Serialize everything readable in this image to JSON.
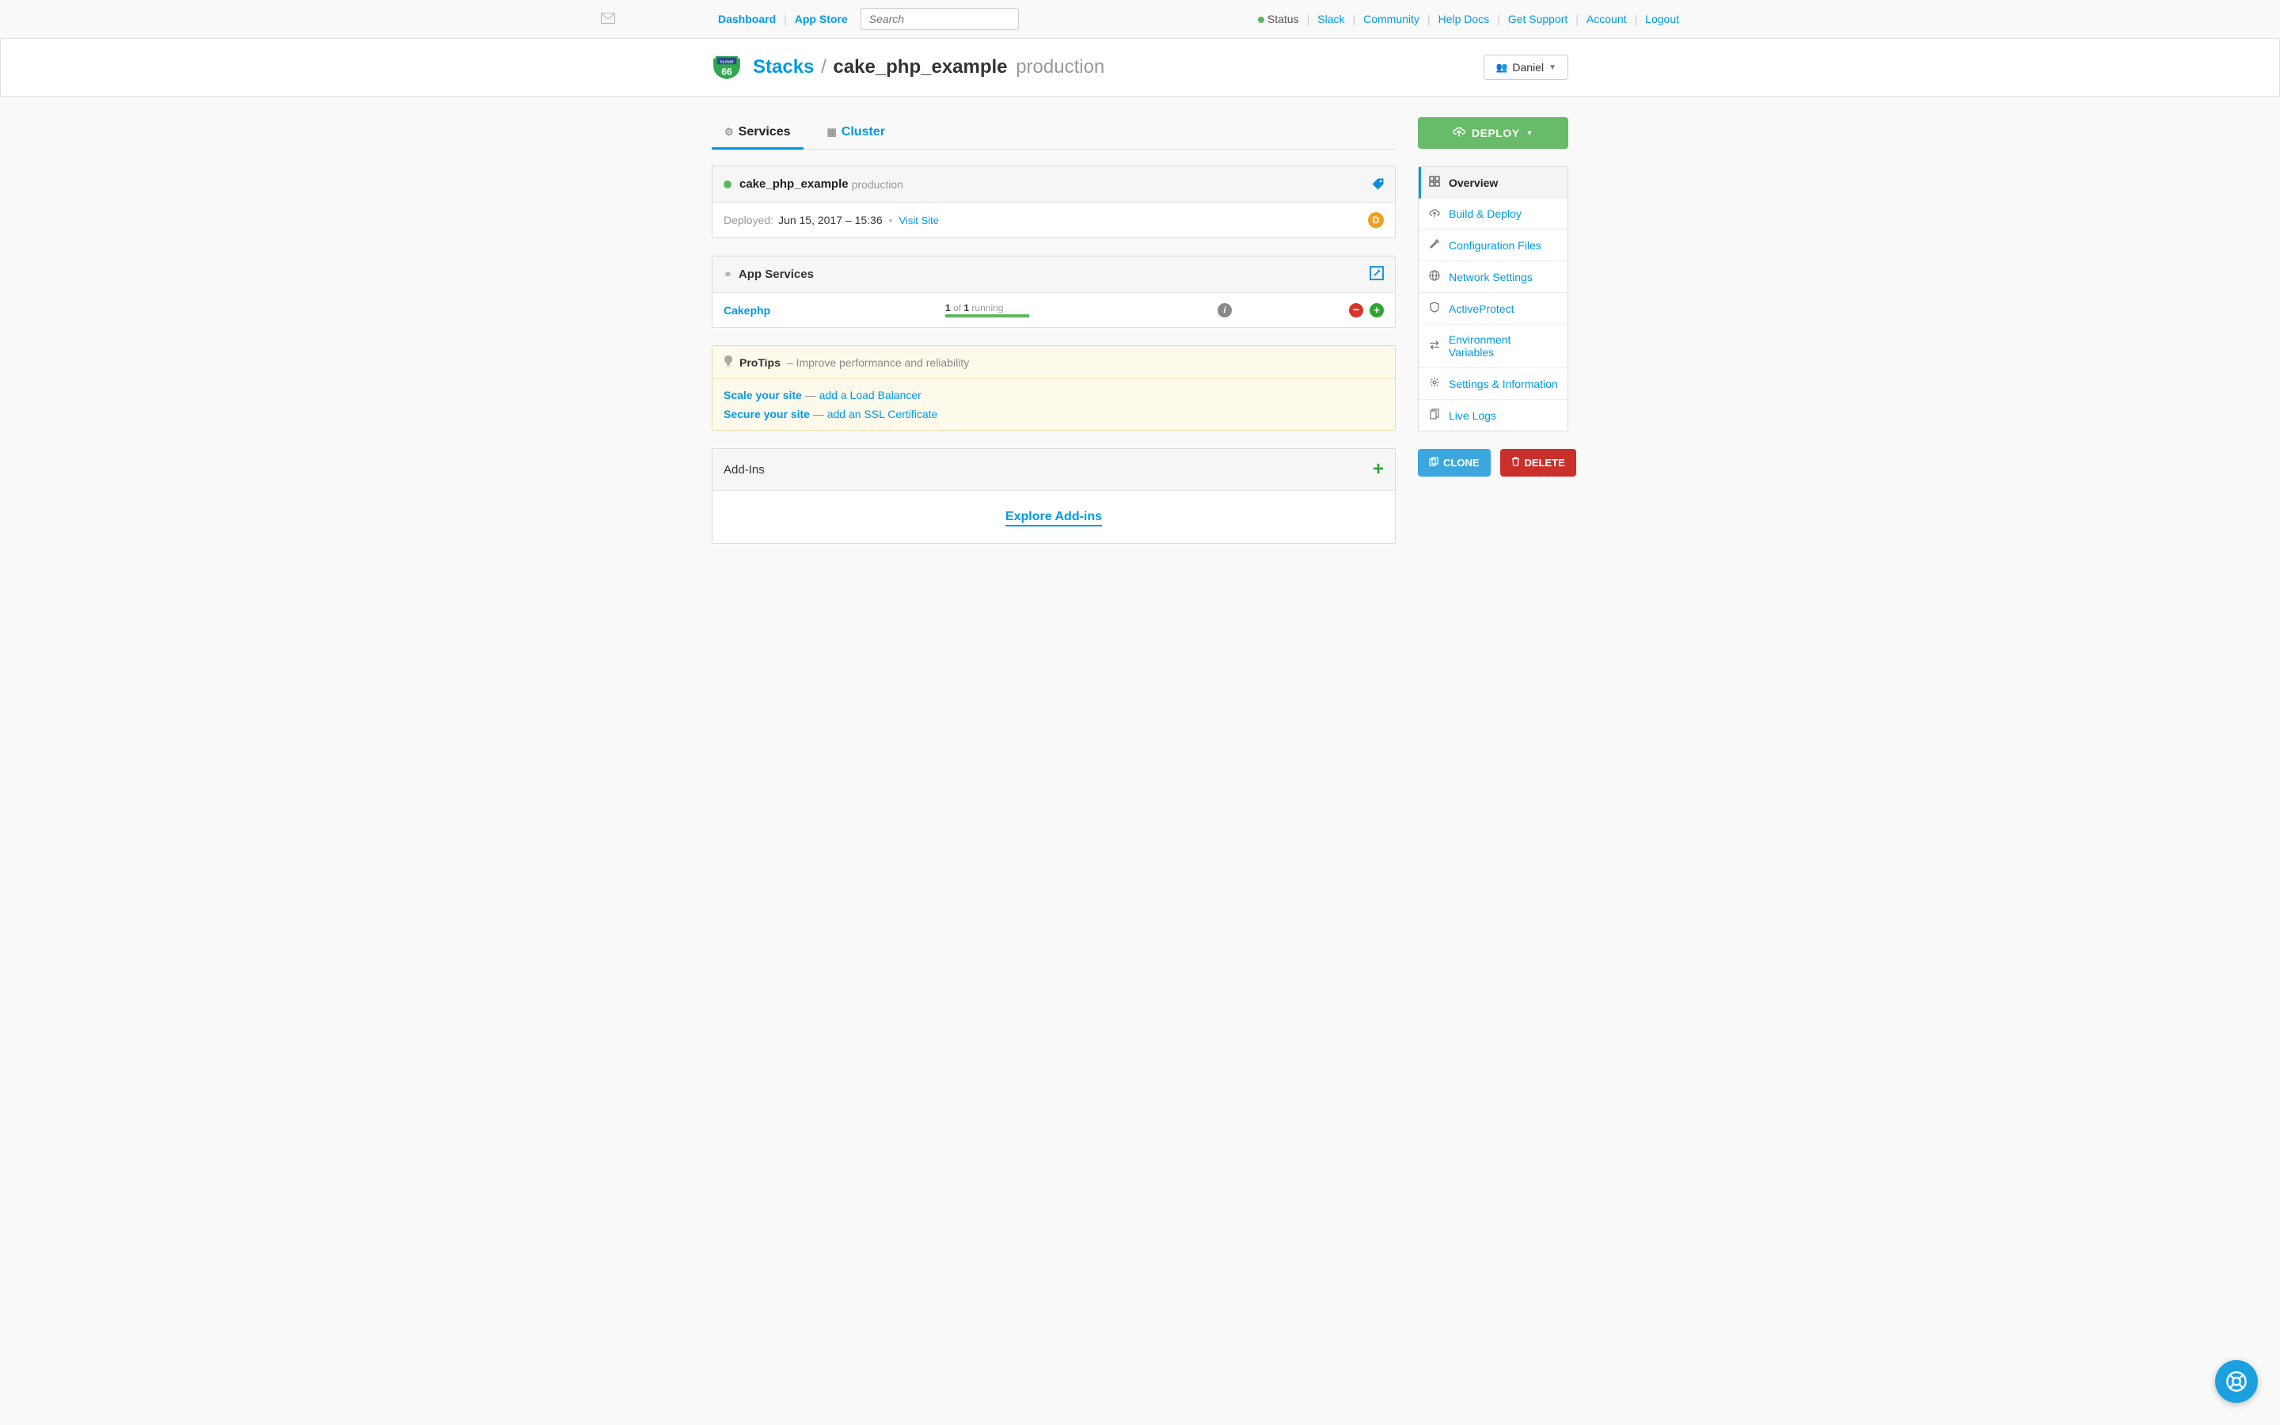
{
  "topbar": {
    "left": {
      "dashboard": "Dashboard",
      "app_store": "App Store"
    },
    "search_placeholder": "Search",
    "right": {
      "status": "Status",
      "slack": "Slack",
      "community": "Community",
      "help_docs": "Help Docs",
      "get_support": "Get Support",
      "account": "Account",
      "logout": "Logout"
    }
  },
  "breadcrumb": {
    "stacks": "Stacks",
    "name": "cake_php_example",
    "env": "production"
  },
  "user_menu": {
    "name": "Daniel"
  },
  "tabs": {
    "services": "Services",
    "cluster": "Cluster"
  },
  "stack_card": {
    "name": "cake_php_example",
    "env": "production",
    "deployed_label": "Deployed:",
    "deployed_date": "Jun 15, 2017 – 15:36",
    "visit_site": "Visit Site",
    "badge": "D"
  },
  "app_services": {
    "title": "App Services",
    "items": [
      {
        "name": "Cakephp",
        "running": 1,
        "total": 1,
        "status_word": "running"
      }
    ],
    "of_word": "of"
  },
  "protips": {
    "title": "ProTips",
    "subtitle": "– Improve performance and reliability",
    "lines": [
      {
        "bold": "Scale your site",
        "rest": "add a Load Balancer"
      },
      {
        "bold": "Secure your site",
        "rest": "add an SSL Certificate"
      }
    ]
  },
  "addins": {
    "title": "Add-Ins",
    "explore": "Explore Add-ins"
  },
  "deploy_btn": "DEPLOY",
  "side_nav": [
    {
      "label": "Overview",
      "icon": "grid",
      "active": true
    },
    {
      "label": "Build & Deploy",
      "icon": "cloud",
      "active": false
    },
    {
      "label": "Configuration Files",
      "icon": "wrench",
      "active": false
    },
    {
      "label": "Network Settings",
      "icon": "globe",
      "active": false
    },
    {
      "label": "ActiveProtect",
      "icon": "shield",
      "active": false
    },
    {
      "label": "Environment Variables",
      "icon": "swap",
      "active": false
    },
    {
      "label": "Settings & Information",
      "icon": "gear",
      "active": false
    },
    {
      "label": "Live Logs",
      "icon": "copy",
      "active": false
    }
  ],
  "clone_btn": "CLONE",
  "delete_btn": "DELETE"
}
